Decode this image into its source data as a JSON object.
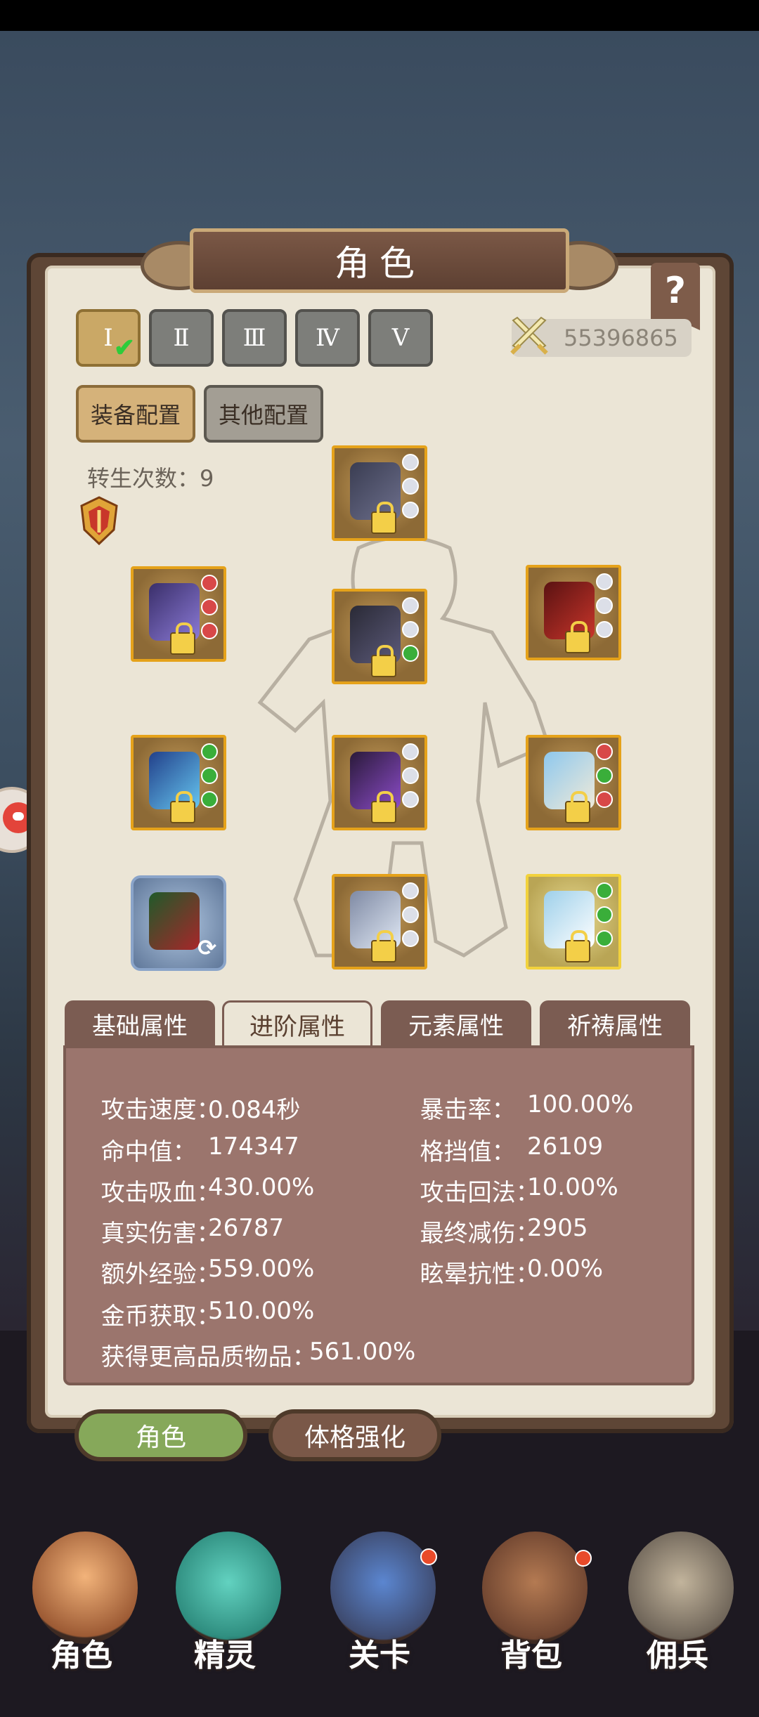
{
  "window": {
    "title": "角色",
    "help_label": "?"
  },
  "loadout_slots": [
    {
      "label": "Ⅰ",
      "active": true
    },
    {
      "label": "Ⅱ",
      "active": false
    },
    {
      "label": "Ⅲ",
      "active": false
    },
    {
      "label": "Ⅳ",
      "active": false
    },
    {
      "label": "Ⅴ",
      "active": false
    }
  ],
  "combat_power": "55396865",
  "config_tabs": {
    "equipment": "装备配置",
    "other": "其他配置"
  },
  "rebirth": {
    "label": "转生次数：9"
  },
  "equipment": [
    {
      "name": "helmet",
      "frame": "orange",
      "gems": [
        "white",
        "white",
        "white"
      ]
    },
    {
      "name": "weapon-scythe",
      "frame": "orange",
      "gems": [
        "red",
        "red",
        "red"
      ]
    },
    {
      "name": "armor",
      "frame": "orange",
      "gems": [
        "white",
        "white",
        "green"
      ]
    },
    {
      "name": "gloves",
      "frame": "orange",
      "gems": [
        "white",
        "white",
        "white"
      ]
    },
    {
      "name": "ring",
      "frame": "orange",
      "gems": [
        "green",
        "green",
        "green"
      ]
    },
    {
      "name": "belt",
      "frame": "orange",
      "gems": [
        "white",
        "white",
        "white"
      ]
    },
    {
      "name": "wings",
      "frame": "orange",
      "gems": [
        "red",
        "green",
        "red"
      ]
    },
    {
      "name": "costume",
      "frame": "special"
    },
    {
      "name": "boots",
      "frame": "orange",
      "gems": [
        "white",
        "white",
        "white"
      ]
    },
    {
      "name": "amulet",
      "frame": "gold",
      "gems": [
        "green",
        "green",
        "green"
      ]
    }
  ],
  "attr_tabs": [
    {
      "label": "基础属性",
      "active": false
    },
    {
      "label": "进阶属性",
      "active": true
    },
    {
      "label": "元素属性",
      "active": false
    },
    {
      "label": "祈祷属性",
      "active": false
    }
  ],
  "stats": {
    "attack_speed": {
      "label": "攻击速度：",
      "value": "0.084秒"
    },
    "crit_rate": {
      "label": "暴击率：",
      "value": "100.00%"
    },
    "hit": {
      "label": "命中值：",
      "value": "174347"
    },
    "block": {
      "label": "格挡值：",
      "value": "26109"
    },
    "lifesteal": {
      "label": "攻击吸血：",
      "value": "430.00%"
    },
    "mana_on_hit": {
      "label": "攻击回法：",
      "value": "10.00%"
    },
    "true_damage": {
      "label": "真实伤害：",
      "value": "26787"
    },
    "final_reduction": {
      "label": "最终减伤：",
      "value": "2905"
    },
    "extra_exp": {
      "label": "额外经验：",
      "value": "559.00%"
    },
    "stun_resist": {
      "label": "眩晕抗性：",
      "value": "0.00%"
    },
    "gold_gain": {
      "label": "金币获取：",
      "value": "510.00%"
    },
    "better_items": {
      "label": "获得更高品质物品：",
      "value": "561.00%"
    }
  },
  "bottom_tabs": {
    "character": "角色",
    "physique": "体格强化"
  },
  "nav": [
    {
      "label": "角色",
      "icon": "hero-icon"
    },
    {
      "label": "精灵",
      "icon": "spirit-icon"
    },
    {
      "label": "关卡",
      "icon": "stage-icon",
      "badge": true
    },
    {
      "label": "背包",
      "icon": "backpack-icon",
      "badge": true
    },
    {
      "label": "佣兵",
      "icon": "mercenary-icon"
    }
  ]
}
